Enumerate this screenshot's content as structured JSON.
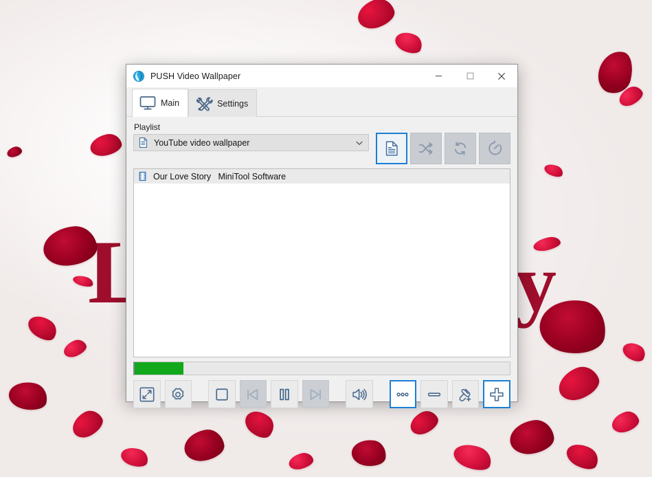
{
  "window": {
    "title": "PUSH Video Wallpaper",
    "app_icon": "globe-app-icon",
    "controls": {
      "minimize": "minimize-icon",
      "maximize": "maximize-icon",
      "close": "close-icon"
    }
  },
  "tabs": [
    {
      "label": "Main",
      "icon": "monitor-icon",
      "active": true
    },
    {
      "label": "Settings",
      "icon": "wrench-screwdriver-icon",
      "active": false
    }
  ],
  "playlist": {
    "label": "Playlist",
    "selected": "YouTube video wallpaper",
    "selected_icon": "document-list-icon",
    "dropdown_icon": "chevron-down-icon",
    "items": [
      {
        "title": "Our Love Story   MiniTool Software",
        "icon": "film-strip-icon",
        "selected": true
      }
    ]
  },
  "toolbar": {
    "buttons": [
      {
        "name": "playlist-view-button",
        "icon": "document-icon",
        "active": true,
        "tooltip": "Playlist"
      },
      {
        "name": "shuffle-button",
        "icon": "shuffle-icon",
        "active": false,
        "tooltip": "Shuffle"
      },
      {
        "name": "repeat-button",
        "icon": "repeat-icon",
        "active": false,
        "tooltip": "Repeat"
      },
      {
        "name": "timer-button",
        "icon": "timer-icon",
        "active": false,
        "tooltip": "Timer"
      }
    ]
  },
  "progress": {
    "percent": 13,
    "fill_color": "#11a81c"
  },
  "controls": {
    "buttons": [
      {
        "name": "fullscreen-button",
        "icon": "expand-icon",
        "state": "enabled"
      },
      {
        "name": "settings-button",
        "icon": "gear-icon",
        "state": "enabled"
      },
      {
        "name": "stop-button",
        "icon": "stop-icon",
        "state": "enabled"
      },
      {
        "name": "previous-button",
        "icon": "previous-icon",
        "state": "disabled"
      },
      {
        "name": "pause-button",
        "icon": "pause-icon",
        "state": "enabled"
      },
      {
        "name": "next-button",
        "icon": "next-icon",
        "state": "disabled"
      },
      {
        "name": "volume-button",
        "icon": "speaker-icon",
        "state": "enabled"
      },
      {
        "name": "more-button",
        "icon": "three-dots-icon",
        "state": "accent"
      },
      {
        "name": "remove-button",
        "icon": "minus-icon",
        "state": "enabled"
      },
      {
        "name": "add-link-button",
        "icon": "link-plus-icon",
        "state": "enabled"
      },
      {
        "name": "add-button",
        "icon": "plus-icon",
        "state": "accent"
      }
    ]
  },
  "wallpaper": {
    "letter_left": "L",
    "letter_right": "y",
    "accent_red": "#9e0e2c",
    "accent_blue": "#1a7fd4"
  }
}
